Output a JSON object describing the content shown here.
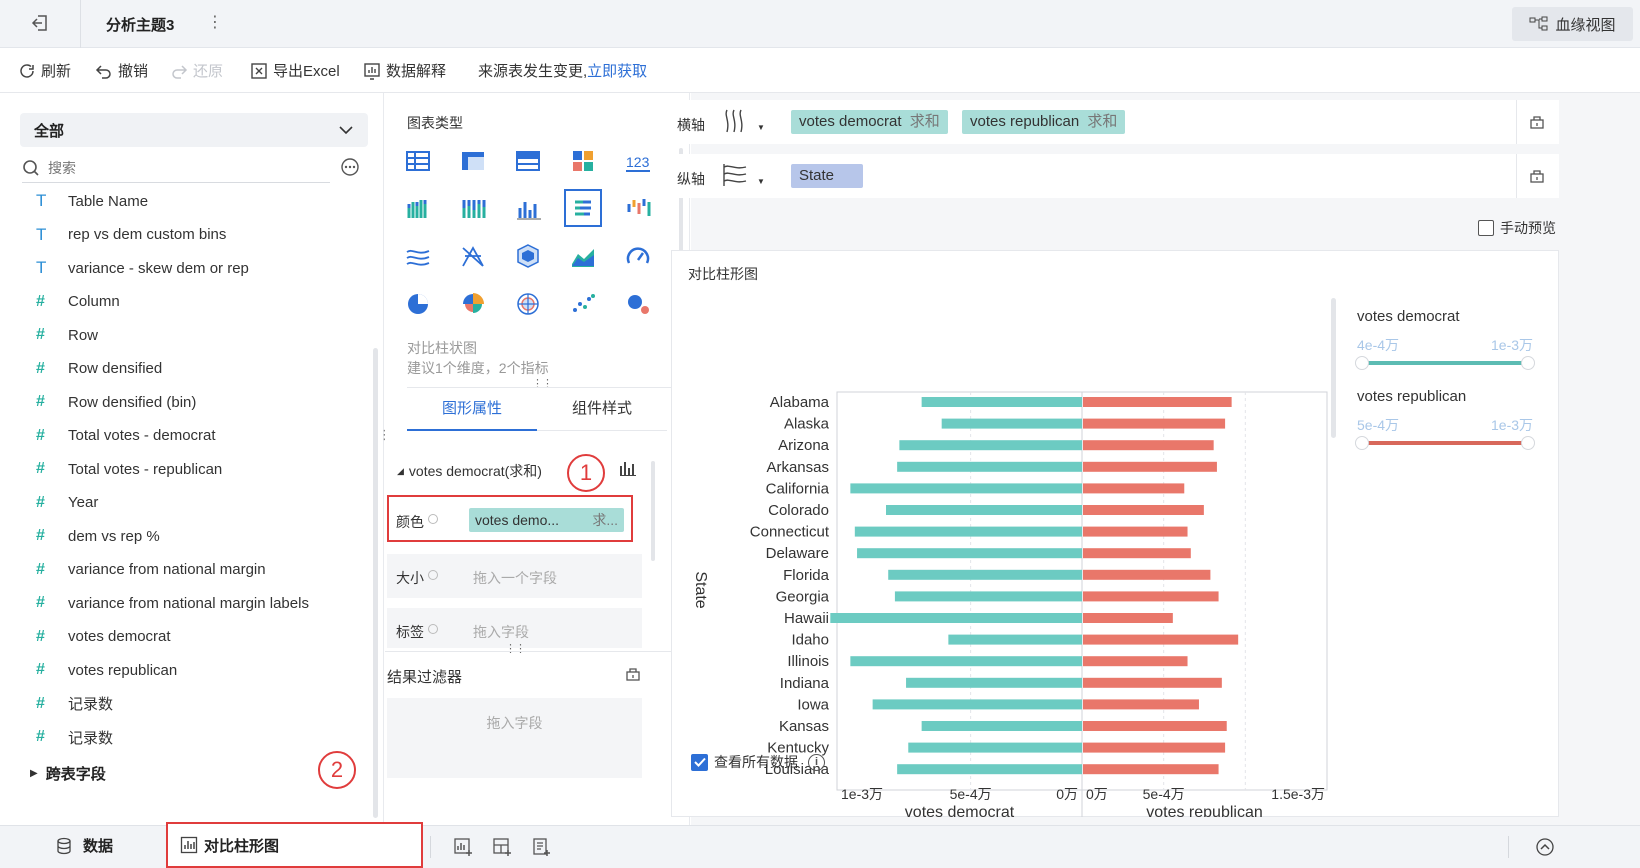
{
  "topbar": {
    "title": "分析主题3",
    "more": "⋮",
    "lineage_label": "血缘视图"
  },
  "toolbar": {
    "refresh": "刷新",
    "undo": "撤销",
    "redo": "还原",
    "export_excel": "导出Excel",
    "data_explain": "数据解释",
    "source_changed": "来源表发生变更,",
    "fetch_now": "立即获取"
  },
  "left": {
    "group_select": "全部",
    "search_placeholder": "搜索",
    "fields": [
      {
        "type": "T",
        "label": "Table Name"
      },
      {
        "type": "T",
        "label": "rep vs dem custom bins"
      },
      {
        "type": "T",
        "label": "variance - skew dem or rep"
      },
      {
        "type": "#",
        "label": "Column"
      },
      {
        "type": "#",
        "label": "Row"
      },
      {
        "type": "#",
        "label": "Row densified"
      },
      {
        "type": "#",
        "label": "Row densified (bin)"
      },
      {
        "type": "#",
        "label": "Total votes - democrat"
      },
      {
        "type": "#",
        "label": "Total votes - republican"
      },
      {
        "type": "#",
        "label": "Year"
      },
      {
        "type": "#",
        "label": "dem vs rep %"
      },
      {
        "type": "#",
        "label": "variance from national margin"
      },
      {
        "type": "#",
        "label": "variance from national margin labels"
      },
      {
        "type": "#",
        "label": "votes democrat"
      },
      {
        "type": "#",
        "label": "votes republican"
      },
      {
        "type": "#",
        "label": "记录数"
      },
      {
        "type": "#",
        "label": "记录数"
      }
    ],
    "cross_table": "跨表字段"
  },
  "mid": {
    "chart_types_title": "图表类型",
    "selected_chart_name": "对比柱状图",
    "selected_chart_hint": "建议1个维度，2个指标",
    "tab_graph": "图形属性",
    "tab_component": "组件样式",
    "measure_header": "votes democrat(求和)",
    "color_label": "颜色",
    "color_field": "votes demo...",
    "color_field_agg": "求...",
    "size_label": "大小",
    "size_placeholder": "拖入一个字段",
    "tag_label": "标签",
    "tag_placeholder": "拖入字段",
    "filter_title": "结果过滤器",
    "filter_placeholder": "拖入字段",
    "annotation_1": "1",
    "annotation_2": "2"
  },
  "right": {
    "x_axis_label": "横轴",
    "x_pill_1": "votes democrat",
    "x_pill_1_agg": "求和",
    "x_pill_2": "votes republican",
    "x_pill_2_agg": "求和",
    "y_axis_label": "纵轴",
    "y_pill": "State",
    "manual_preview": "手动预览",
    "chart_title": "对比柱形图",
    "view_all_data": "查看所有数据",
    "legend_dem_title": "votes democrat",
    "legend_dem_min": "4e-4万",
    "legend_dem_max": "1e-3万",
    "legend_rep_title": "votes republican",
    "legend_rep_min": "5e-4万",
    "legend_rep_max": "1e-3万"
  },
  "bottom": {
    "data_tab": "数据",
    "chart_tab": "对比柱形图"
  },
  "colors": {
    "democrat": "#6ccbc2",
    "republican": "#e9776a",
    "accent": "#2d6fd6"
  },
  "chart_data": {
    "type": "bar",
    "title": "对比柱形图",
    "ylabel": "State",
    "categories": [
      "Alabama",
      "Alaska",
      "Arizona",
      "Arkansas",
      "California",
      "Colorado",
      "Connecticut",
      "Delaware",
      "Florida",
      "Georgia",
      "Hawaii",
      "Idaho",
      "Illinois",
      "Indiana",
      "Iowa",
      "Kansas",
      "Kentucky",
      "Louisiana"
    ],
    "series": [
      {
        "name": "votes democrat",
        "xlabel": "votes democrat",
        "ticks": [
          "1e-3万",
          "5e-4万",
          "0万"
        ],
        "xlim": [
          0,
          0.0011
        ],
        "values": [
          0.00072,
          0.00063,
          0.00082,
          0.00083,
          0.00104,
          0.00088,
          0.00102,
          0.00101,
          0.00087,
          0.00084,
          0.00113,
          0.0006,
          0.00104,
          0.00079,
          0.00094,
          0.00072,
          0.00078,
          0.00083
        ]
      },
      {
        "name": "votes republican",
        "xlabel": "votes republican",
        "ticks": [
          "0万",
          "5e-4万",
          "1.5e-3万"
        ],
        "xlim": [
          0,
          0.0015
        ],
        "values": [
          0.00091,
          0.00087,
          0.0008,
          0.00082,
          0.00062,
          0.00074,
          0.00064,
          0.00066,
          0.00078,
          0.00083,
          0.00055,
          0.00095,
          0.00064,
          0.00085,
          0.00071,
          0.00088,
          0.00087,
          0.00083
        ]
      }
    ]
  }
}
